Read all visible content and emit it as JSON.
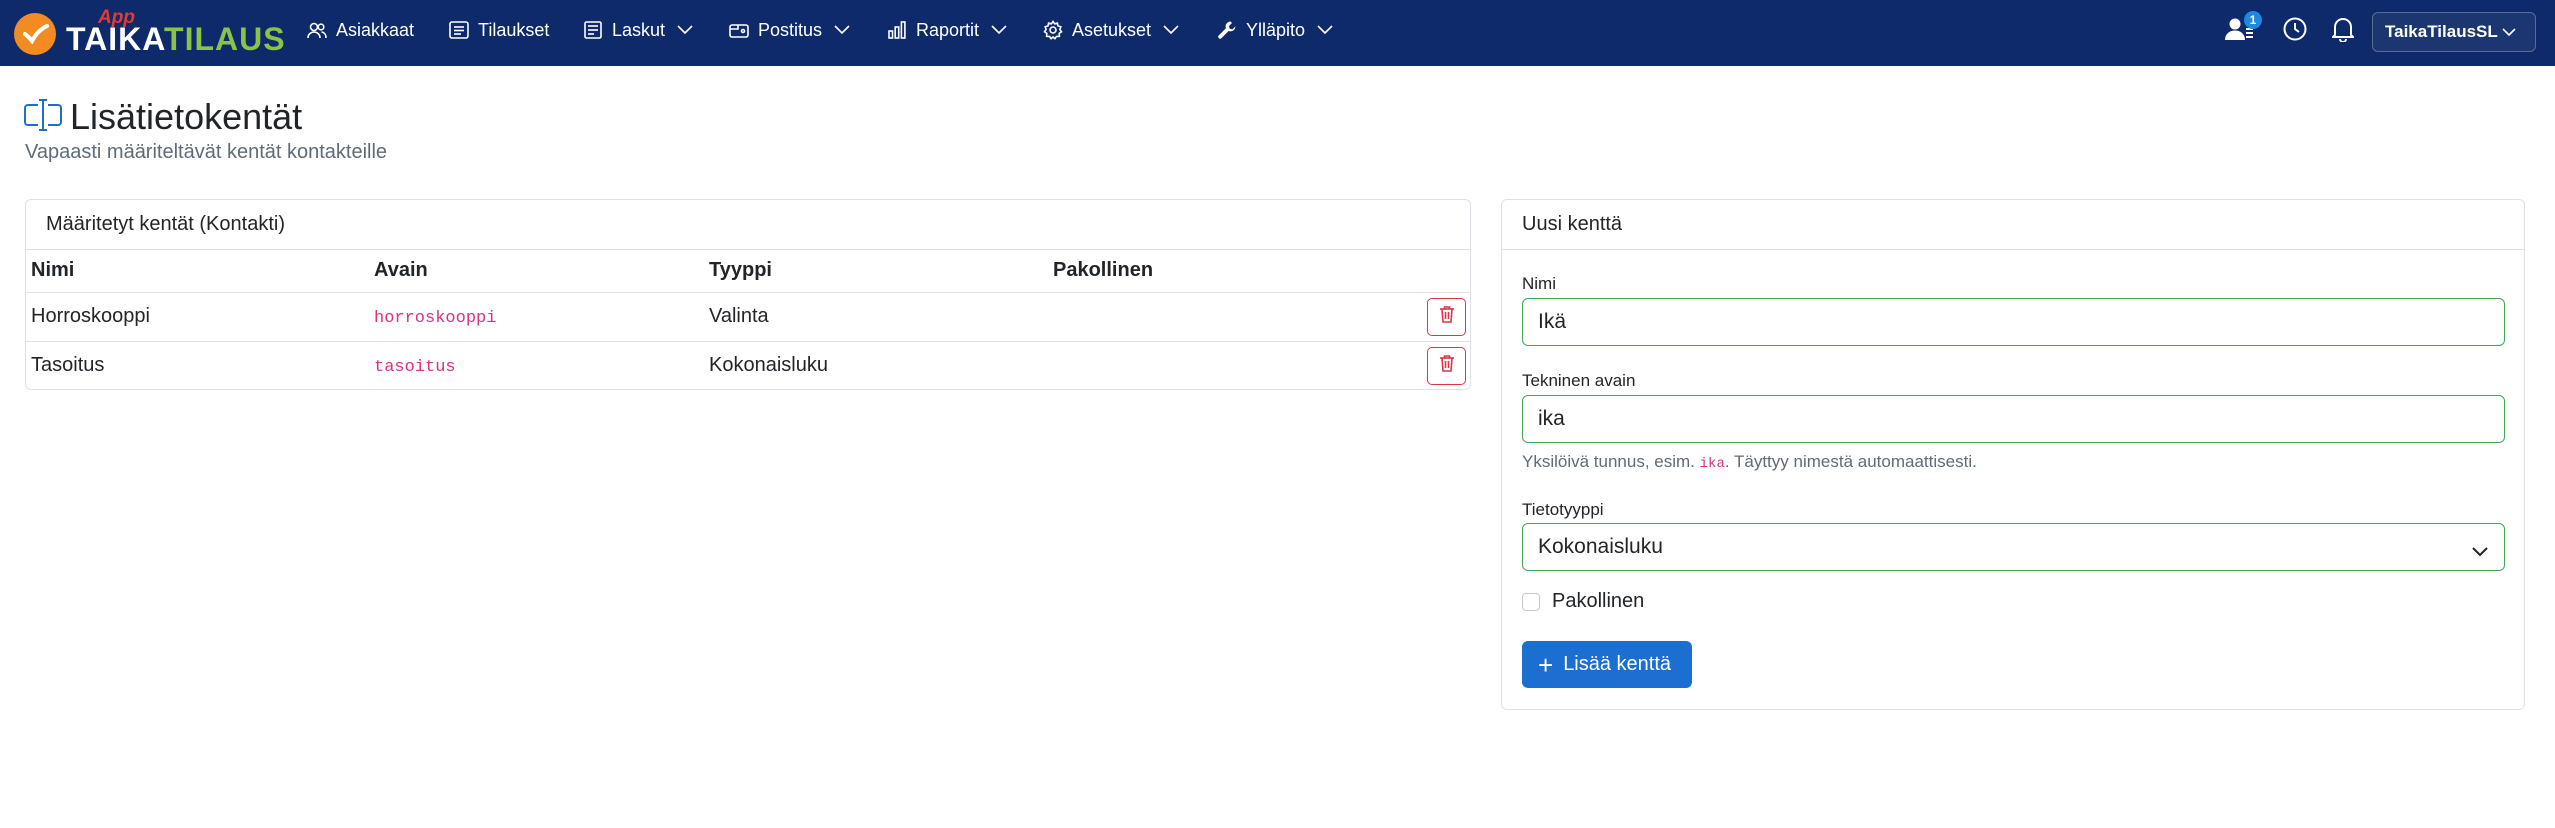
{
  "brand": {
    "app_tag": "App",
    "name_part1": "TAIKA",
    "name_part2": "TILAUS"
  },
  "nav": {
    "items": [
      {
        "label": "Asiakkaat",
        "icon": "users-icon",
        "dropdown": false
      },
      {
        "label": "Tilaukset",
        "icon": "list-icon",
        "dropdown": false
      },
      {
        "label": "Laskut",
        "icon": "invoice-icon",
        "dropdown": true
      },
      {
        "label": "Postitus",
        "icon": "mail-icon",
        "dropdown": true
      },
      {
        "label": "Raportit",
        "icon": "chart-icon",
        "dropdown": true
      },
      {
        "label": "Asetukset",
        "icon": "gear-icon",
        "dropdown": true
      },
      {
        "label": "Ylläpito",
        "icon": "wrench-icon",
        "dropdown": true
      }
    ],
    "notification_count": "1",
    "user_label": "TaikaTilausSL"
  },
  "page": {
    "title": "Lisätietokentät",
    "subtitle": "Vapaasti määriteltävät kentät kontakteille"
  },
  "fields_card": {
    "header": "Määritetyt kentät (Kontakti)",
    "columns": [
      "Nimi",
      "Avain",
      "Tyyppi",
      "Pakollinen"
    ],
    "rows": [
      {
        "name": "Horroskooppi",
        "key": "horroskooppi",
        "type": "Valinta",
        "required": ""
      },
      {
        "name": "Tasoitus",
        "key": "tasoitus",
        "type": "Kokonaisluku",
        "required": ""
      }
    ]
  },
  "new_field": {
    "header": "Uusi kenttä",
    "name_label": "Nimi",
    "name_value": "Ikä",
    "key_label": "Tekninen avain",
    "key_value": "ika",
    "help_prefix": "Yksilöivä tunnus, esim.",
    "help_code": "ika",
    "help_suffix": ". Täyttyy nimestä automaattisesti.",
    "type_label": "Tietotyyppi",
    "type_value": "Kokonaisluku",
    "required_label": "Pakollinen",
    "required_checked": false,
    "submit_label": "Lisää kenttä"
  },
  "colors": {
    "navbar": "#0f2a6b",
    "primary": "#1a6fd1",
    "danger": "#dc3545",
    "valid": "#3fa55b",
    "code": "#d63384"
  }
}
